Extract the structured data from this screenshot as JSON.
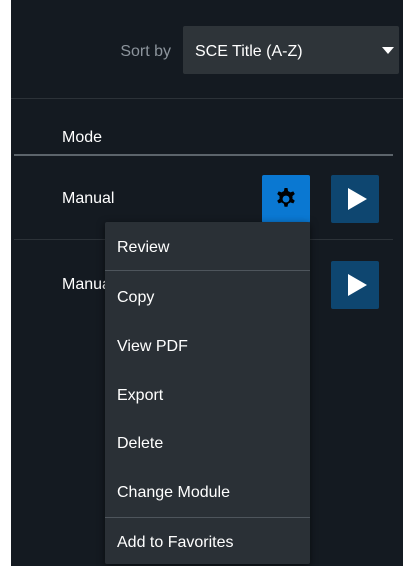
{
  "sort": {
    "label": "Sort by",
    "selected": "SCE Title (A-Z)"
  },
  "table": {
    "column_header": "Mode",
    "rows": [
      {
        "mode": "Manual"
      },
      {
        "mode": "Manual"
      }
    ]
  },
  "context_menu": {
    "items": [
      {
        "label": "Review"
      },
      {
        "label": "Copy"
      },
      {
        "label": "View PDF"
      },
      {
        "label": "Export"
      },
      {
        "label": "Delete"
      },
      {
        "label": "Change Module"
      },
      {
        "label": "Add to Favorites"
      }
    ]
  },
  "icons": {
    "settings": "gear-icon",
    "play": "play-icon",
    "dropdown": "chevron-down-icon"
  },
  "colors": {
    "background": "#141a21",
    "settings_button": "#0a78d2",
    "play_button": "#0e4670",
    "menu_background": "#2a3036",
    "select_background": "#2e3439"
  }
}
